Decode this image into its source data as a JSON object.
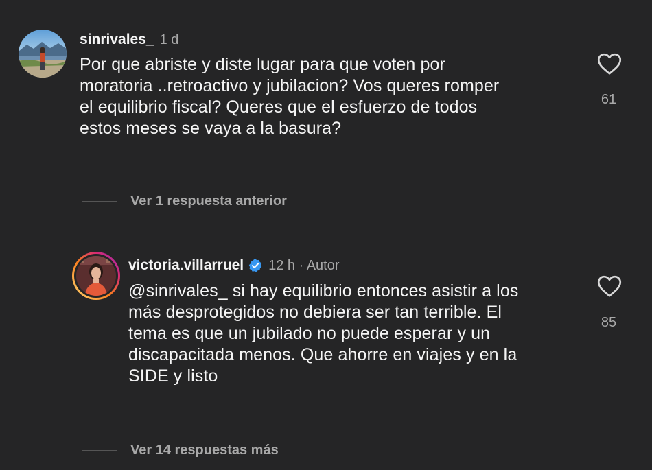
{
  "comment": {
    "username": "sinrivales_",
    "time": "1 d",
    "text": "Por que abriste  y diste lugar para que voten por\nmoratoria ..retroactivo y jubilacion? Vos queres romper\nel equilibrio fiscal? Queres que el esfuerzo de todos\nestos meses se vaya a la basura?",
    "likes": "61",
    "like_icon": "heart-outline-icon"
  },
  "view_previous": {
    "label": "Ver 1 respuesta anterior"
  },
  "reply": {
    "username": "victoria.villarruel",
    "verified_icon": "verified-badge-icon",
    "time": "12 h · Autor",
    "text": "@sinrivales_ si hay equilibrio entonces asistir a los\nmás desprotegidos no debiera ser tan terrible. El\ntema es que un jubilado no puede esperar y un\ndiscapacitada menos. Que ahorre en viajes y en la\nSIDE y listo",
    "likes": "85",
    "like_icon": "heart-outline-icon"
  },
  "view_more": {
    "label": "Ver 14 respuestas más"
  },
  "colors": {
    "background": "#252526",
    "text": "#f5f5f5",
    "secondary": "#a8a8a8",
    "verified": "#3897f0",
    "story_ring_start": "#feda75",
    "story_ring_end": "#d62976"
  }
}
